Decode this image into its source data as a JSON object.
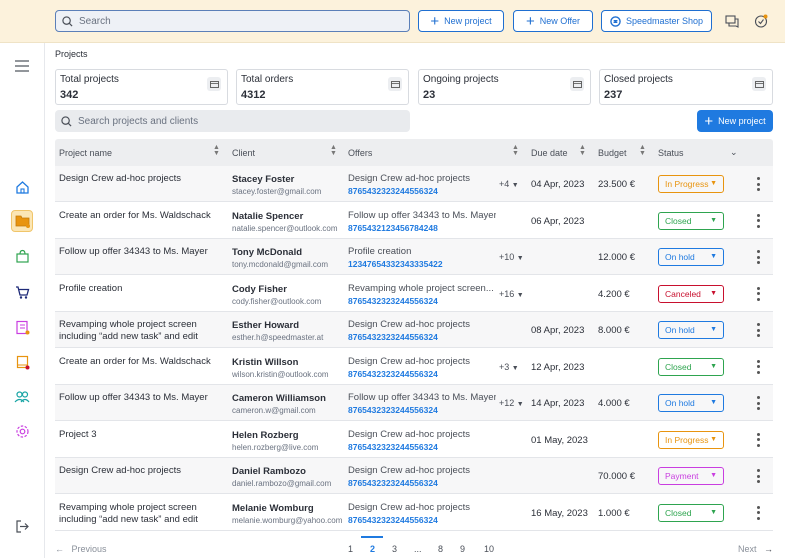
{
  "topbar": {
    "search_placeholder": "Search",
    "new_project_label": "New project",
    "new_offer_label": "New Offer",
    "shop_label": "Speedmaster Shop"
  },
  "sidebar": {
    "items": [
      "menu-icon",
      "home-icon",
      "projects-icon",
      "bag-icon",
      "cart-icon",
      "catalog-icon",
      "book-icon",
      "users-icon",
      "settings-icon",
      "logout-icon"
    ]
  },
  "breadcrumb": "Projects",
  "stats": [
    {
      "label": "Total projects",
      "value": "342"
    },
    {
      "label": "Total orders",
      "value": "4312"
    },
    {
      "label": "Ongoing projects",
      "value": "23"
    },
    {
      "label": "Closed projects",
      "value": "237"
    }
  ],
  "filter": {
    "search_placeholder": "Search projects and clients",
    "new_project_label": "New project"
  },
  "table": {
    "headers": [
      "Project name",
      "Client",
      "Offers",
      "Due date",
      "Budget",
      "Status"
    ],
    "rows": [
      {
        "project": "Design Crew ad-hoc projects",
        "client": "Stacey Foster",
        "email": "stacey.foster@gmail.com",
        "offer": "Design Crew ad-hoc projects",
        "offer_no": "8765432323244556324",
        "more": "+4",
        "due": "04 Apr, 2023",
        "budget": "23.500 €",
        "status": "In Progress"
      },
      {
        "project": "Create an order for Ms. Waldschack",
        "client": "Natalie Spencer",
        "email": "natalie.spencer@outlook.com",
        "offer": "Follow up offer 34343 to Ms. Mayer",
        "offer_no": "8765432123456784248",
        "more": "",
        "due": "06 Apr, 2023",
        "budget": "",
        "status": "Closed"
      },
      {
        "project": "Follow up offer 34343 to Ms. Mayer",
        "client": "Tony McDonald",
        "email": "tony.mcdonald@gmail.com",
        "offer": "Profile creation",
        "offer_no": "12347654332343335422",
        "more": "+10",
        "due": "",
        "budget": "12.000 €",
        "status": "On hold"
      },
      {
        "project": "Profile creation",
        "client": "Cody Fisher",
        "email": "cody.fisher@outlook.com",
        "offer": "Revamping whole project screen...",
        "offer_no": "8765432323244556324",
        "more": "+16",
        "due": "",
        "budget": "4.200 €",
        "status": "Canceled"
      },
      {
        "project": "Revamping whole project screen including “add new task” and edit",
        "client": "Esther Howard",
        "email": "esther.h@speedmaster.at",
        "offer": "Design Crew ad-hoc projects",
        "offer_no": "8765432323244556324",
        "more": "",
        "due": "08 Apr, 2023",
        "budget": "8.000 €",
        "status": "On hold"
      },
      {
        "project": "Create an order for Ms. Waldschack",
        "client": "Kristin Willson",
        "email": "wilson.kristin@outlook.com",
        "offer": "Design Crew ad-hoc projects",
        "offer_no": "8765432323244556324",
        "more": "+3",
        "due": "12 Apr, 2023",
        "budget": "",
        "status": "Closed"
      },
      {
        "project": "Follow up offer 34343 to Ms. Mayer",
        "client": "Cameron Williamson",
        "email": "cameron.w@gmail.com",
        "offer": "Follow up offer 34343 to Ms. Mayer",
        "offer_no": "8765432323244556324",
        "more": "+12",
        "due": "14 Apr, 2023",
        "budget": "4.000 €",
        "status": "On hold"
      },
      {
        "project": "Project 3",
        "client": "Helen Rozberg",
        "email": "helen.rozberg@live.com",
        "offer": "Design Crew ad-hoc projects",
        "offer_no": "8765432323244556324",
        "more": "",
        "due": "01 May, 2023",
        "budget": "",
        "status": "In Progress"
      },
      {
        "project": "Design Crew ad-hoc projects",
        "client": "Daniel Rambozo",
        "email": "daniel.rambozo@gmail.com",
        "offer": "Design Crew ad-hoc projects",
        "offer_no": "8765432323244556324",
        "more": "",
        "due": "",
        "budget": "70.000 €",
        "status": "Payment"
      },
      {
        "project": "Revamping whole project screen including “add new task” and edit",
        "client": "Melanie Womburg",
        "email": "melanie.womburg@yahoo.com",
        "offer": "Design Crew ad-hoc projects",
        "offer_no": "8765432323244556324",
        "more": "",
        "due": "16 May, 2023",
        "budget": "1.000 €",
        "status": "Closed"
      }
    ]
  },
  "status_colors": {
    "In Progress": "#e8940f",
    "Closed": "#2ea44f",
    "On hold": "#1f7ae0",
    "Canceled": "#c8102e",
    "Payment": "#c93ee0"
  },
  "pagination": {
    "previous": "Previous",
    "next": "Next",
    "pages": [
      "1",
      "2",
      "3",
      "...",
      "8",
      "9",
      "10"
    ],
    "current": "2"
  }
}
